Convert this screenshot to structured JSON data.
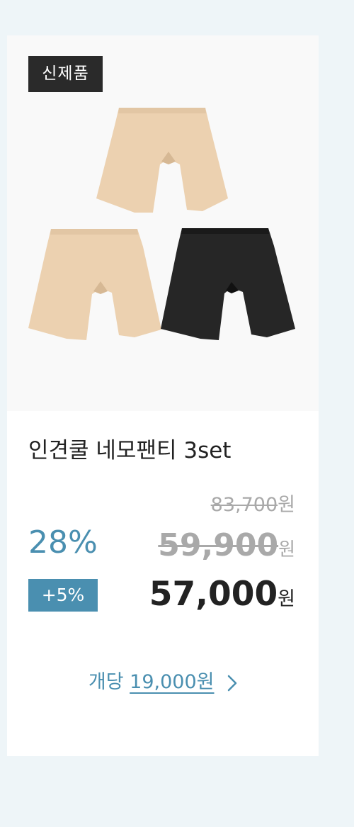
{
  "product": {
    "badge": "신제품",
    "name": "인견쿨 네모팬티 3set",
    "image_alt": "three pairs of boxer shorts: two beige, one black",
    "price": {
      "original_value": "83,700",
      "original_unit": "원",
      "discount_rate": "28%",
      "sale_value": "59,900",
      "sale_unit": "원",
      "extra_discount": "+5%",
      "final_value": "57,000",
      "final_unit": "원"
    },
    "per_unit": {
      "label": "개당",
      "amount": "19,000원"
    }
  },
  "colors": {
    "accent": "#4a8fb0",
    "badge_bg": "#2a2a2a",
    "strike": "#a9a9a9",
    "page_bg": "#eef5f8",
    "beige": "#ecd1b0",
    "black": "#262626"
  }
}
